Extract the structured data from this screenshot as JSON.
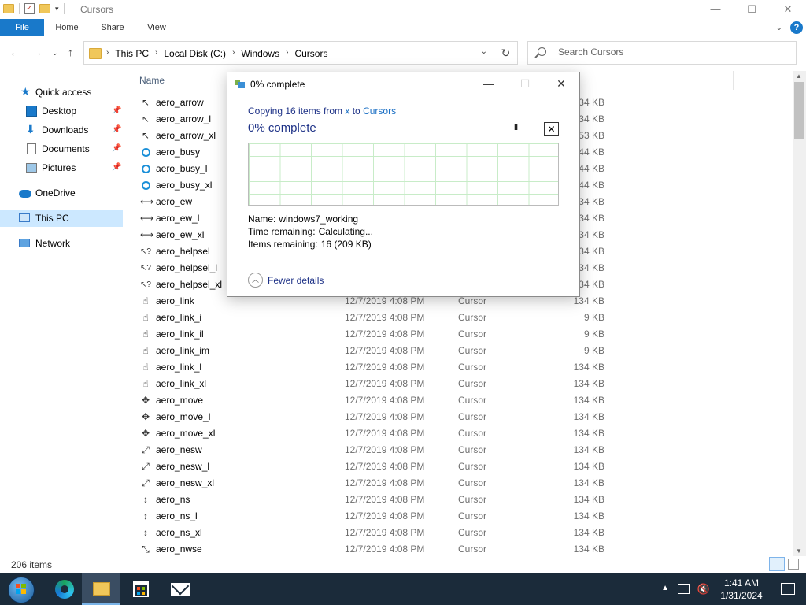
{
  "window": {
    "title": "Cursors",
    "controls": {
      "minimize": "—",
      "maximize": "☐",
      "close": "✕"
    }
  },
  "ribbon": {
    "tabs": [
      "File",
      "Home",
      "Share",
      "View"
    ]
  },
  "address": {
    "crumbs": [
      "This PC",
      "Local Disk (C:)",
      "Windows",
      "Cursors"
    ],
    "search_placeholder": "Search Cursors"
  },
  "sidebar": {
    "items": [
      {
        "label": "Quick access",
        "icon": "star-icon"
      },
      {
        "label": "Desktop",
        "icon": "desktop-icon",
        "pinned": true
      },
      {
        "label": "Downloads",
        "icon": "download-icon",
        "pinned": true
      },
      {
        "label": "Documents",
        "icon": "documents-icon",
        "pinned": true
      },
      {
        "label": "Pictures",
        "icon": "pictures-icon",
        "pinned": true
      },
      {
        "label": "OneDrive",
        "icon": "cloud-icon"
      },
      {
        "label": "This PC",
        "icon": "computer-icon",
        "selected": true
      },
      {
        "label": "Network",
        "icon": "network-icon"
      }
    ]
  },
  "list": {
    "column_name": "Name",
    "rows": [
      {
        "name": "aero_arrow",
        "icon": "arrow",
        "date": "",
        "type": "",
        "size": "134 KB"
      },
      {
        "name": "aero_arrow_l",
        "icon": "arrow",
        "date": "",
        "type": "",
        "size": "134 KB"
      },
      {
        "name": "aero_arrow_xl",
        "icon": "arrow",
        "date": "",
        "type": "",
        "size": "153 KB"
      },
      {
        "name": "aero_busy",
        "icon": "busy",
        "date": "",
        "type": "",
        "size": "544 KB"
      },
      {
        "name": "aero_busy_l",
        "icon": "busy",
        "date": "",
        "type": "",
        "size": "544 KB"
      },
      {
        "name": "aero_busy_xl",
        "icon": "busy",
        "date": "",
        "type": "",
        "size": "544 KB"
      },
      {
        "name": "aero_ew",
        "icon": "ew",
        "date": "",
        "type": "",
        "size": "134 KB"
      },
      {
        "name": "aero_ew_l",
        "icon": "ew",
        "date": "",
        "type": "",
        "size": "134 KB"
      },
      {
        "name": "aero_ew_xl",
        "icon": "ew",
        "date": "",
        "type": "",
        "size": "134 KB"
      },
      {
        "name": "aero_helpsel",
        "icon": "help",
        "date": "",
        "type": "",
        "size": "134 KB"
      },
      {
        "name": "aero_helpsel_l",
        "icon": "help",
        "date": "",
        "type": "",
        "size": "134 KB"
      },
      {
        "name": "aero_helpsel_xl",
        "icon": "help",
        "date": "",
        "type": "",
        "size": "134 KB"
      },
      {
        "name": "aero_link",
        "icon": "hand",
        "date": "12/7/2019 4:08 PM",
        "type": "Cursor",
        "size": "134 KB"
      },
      {
        "name": "aero_link_i",
        "icon": "hand-bold",
        "date": "12/7/2019 4:08 PM",
        "type": "Cursor",
        "size": "9 KB"
      },
      {
        "name": "aero_link_il",
        "icon": "hand-bold",
        "date": "12/7/2019 4:08 PM",
        "type": "Cursor",
        "size": "9 KB"
      },
      {
        "name": "aero_link_im",
        "icon": "hand-bold",
        "date": "12/7/2019 4:08 PM",
        "type": "Cursor",
        "size": "9 KB"
      },
      {
        "name": "aero_link_l",
        "icon": "hand",
        "date": "12/7/2019 4:08 PM",
        "type": "Cursor",
        "size": "134 KB"
      },
      {
        "name": "aero_link_xl",
        "icon": "hand",
        "date": "12/7/2019 4:08 PM",
        "type": "Cursor",
        "size": "134 KB"
      },
      {
        "name": "aero_move",
        "icon": "move",
        "date": "12/7/2019 4:08 PM",
        "type": "Cursor",
        "size": "134 KB"
      },
      {
        "name": "aero_move_l",
        "icon": "move",
        "date": "12/7/2019 4:08 PM",
        "type": "Cursor",
        "size": "134 KB"
      },
      {
        "name": "aero_move_xl",
        "icon": "move",
        "date": "12/7/2019 4:08 PM",
        "type": "Cursor",
        "size": "134 KB"
      },
      {
        "name": "aero_nesw",
        "icon": "nesw",
        "date": "12/7/2019 4:08 PM",
        "type": "Cursor",
        "size": "134 KB"
      },
      {
        "name": "aero_nesw_l",
        "icon": "nesw",
        "date": "12/7/2019 4:08 PM",
        "type": "Cursor",
        "size": "134 KB"
      },
      {
        "name": "aero_nesw_xl",
        "icon": "nesw",
        "date": "12/7/2019 4:08 PM",
        "type": "Cursor",
        "size": "134 KB"
      },
      {
        "name": "aero_ns",
        "icon": "ns",
        "date": "12/7/2019 4:08 PM",
        "type": "Cursor",
        "size": "134 KB"
      },
      {
        "name": "aero_ns_l",
        "icon": "ns",
        "date": "12/7/2019 4:08 PM",
        "type": "Cursor",
        "size": "134 KB"
      },
      {
        "name": "aero_ns_xl",
        "icon": "ns",
        "date": "12/7/2019 4:08 PM",
        "type": "Cursor",
        "size": "134 KB"
      },
      {
        "name": "aero_nwse",
        "icon": "nwse",
        "date": "12/7/2019 4:08 PM",
        "type": "Cursor",
        "size": "134 KB"
      }
    ]
  },
  "status": {
    "item_count": "206 items"
  },
  "dialog": {
    "title": "0% complete",
    "copy_prefix": "Copying 16 items from ",
    "copy_from": "x",
    "copy_mid": " to ",
    "copy_to": "Cursors",
    "percent_heading": "0% complete",
    "progress_fraction": 0,
    "name_label": "Name:",
    "name_value": "windows7_working",
    "time_label": "Time remaining:",
    "time_value": "Calculating...",
    "items_label": "Items remaining:",
    "items_value": "16 (209 KB)",
    "fewer_details": "Fewer details",
    "controls": {
      "minimize": "—",
      "maximize": "☐",
      "close": "✕"
    },
    "pause": "II",
    "cancel": "✕"
  },
  "taskbar": {
    "time": "1:41 AM",
    "date": "1/31/2024"
  },
  "colors": {
    "accent": "#1979ca",
    "selection": "#cce8ff",
    "taskbar": "#1b2b3a",
    "dialog_text": "#1e3287",
    "graph_grid": "#c8ecc8"
  }
}
